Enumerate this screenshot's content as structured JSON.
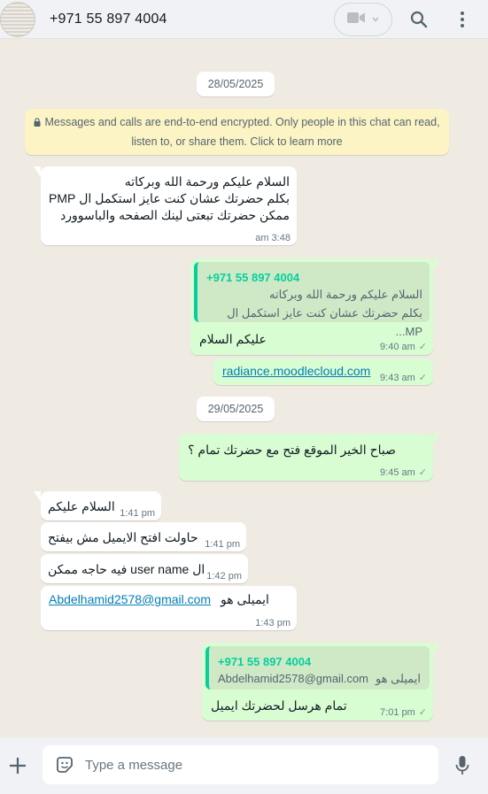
{
  "header": {
    "contact_name": "+971 55 897 4004",
    "avatar_icon": "avatar-image",
    "video_icon": "video-camera-icon",
    "search_icon": "search-icon",
    "menu_icon": "vertical-dots-icon"
  },
  "dates": {
    "first": "28/05/2025",
    "second": "29/05/2025"
  },
  "encryption_notice": {
    "line1": "Messages and calls are end-to-end encrypted. Only people in this chat can read,",
    "line2": "listen to, or share them. Click to learn more",
    "icon": "lock-icon"
  },
  "messages": [
    {
      "direction": "in",
      "lines": [
        "السلام عليكم ورحمة الله وبركاته",
        "بكلم حضرتك عشان كنت عايز استكمل ال PMP",
        "ممكن حضرتك تبعتى لينك الصفحه والباسوورد"
      ],
      "time": "3:48 am"
    },
    {
      "direction": "out",
      "quote_name": "+971 55 897 4004",
      "quote_lines": [
        "السلام عليكم ورحمة الله وبركاته",
        "بكلم حضرتك عشان كنت عايز استكمل ال MP..."
      ],
      "text": "عليكم السلام",
      "time": "9:40 am"
    },
    {
      "direction": "out",
      "link": "radiance.moodlecloud.com",
      "time": "9:43 am"
    },
    {
      "direction": "out",
      "text": "صباح الخير الموقع فتح مع حضرتك تمام ؟",
      "time": "9:45 am"
    },
    {
      "direction": "in",
      "text": "السلام عليكم",
      "time": "1:41 pm"
    },
    {
      "direction": "in",
      "text": "حاولت افتح الايميل مش بيفتح",
      "time": "1:41 pm"
    },
    {
      "direction": "in",
      "text": "ال user name فيه حاجه ممكن",
      "time": "1:42 pm"
    },
    {
      "direction": "in",
      "text": "ايميلى هو",
      "link": "Abdelhamid2578@gmail.com",
      "time": "1:43 pm"
    },
    {
      "direction": "out",
      "quote_name": "+971 55 897 4004",
      "quote_text": "ايميلى هو",
      "quote_link": "Abdelhamid2578@gmail.com",
      "text": "تمام هرسل لحضرتك ايميل",
      "time": "7:01 pm"
    }
  ],
  "composer": {
    "placeholder": "Type a message",
    "attach_icon": "plus-icon",
    "sticker_icon": "sticker-icon",
    "mic_icon": "microphone-icon"
  },
  "colors": {
    "outgoing_bubble": "#d9fdd3",
    "incoming_bubble": "#ffffff",
    "chat_background": "#efeae2",
    "quote_accent": "#06cf9c",
    "link": "#027eb5"
  }
}
